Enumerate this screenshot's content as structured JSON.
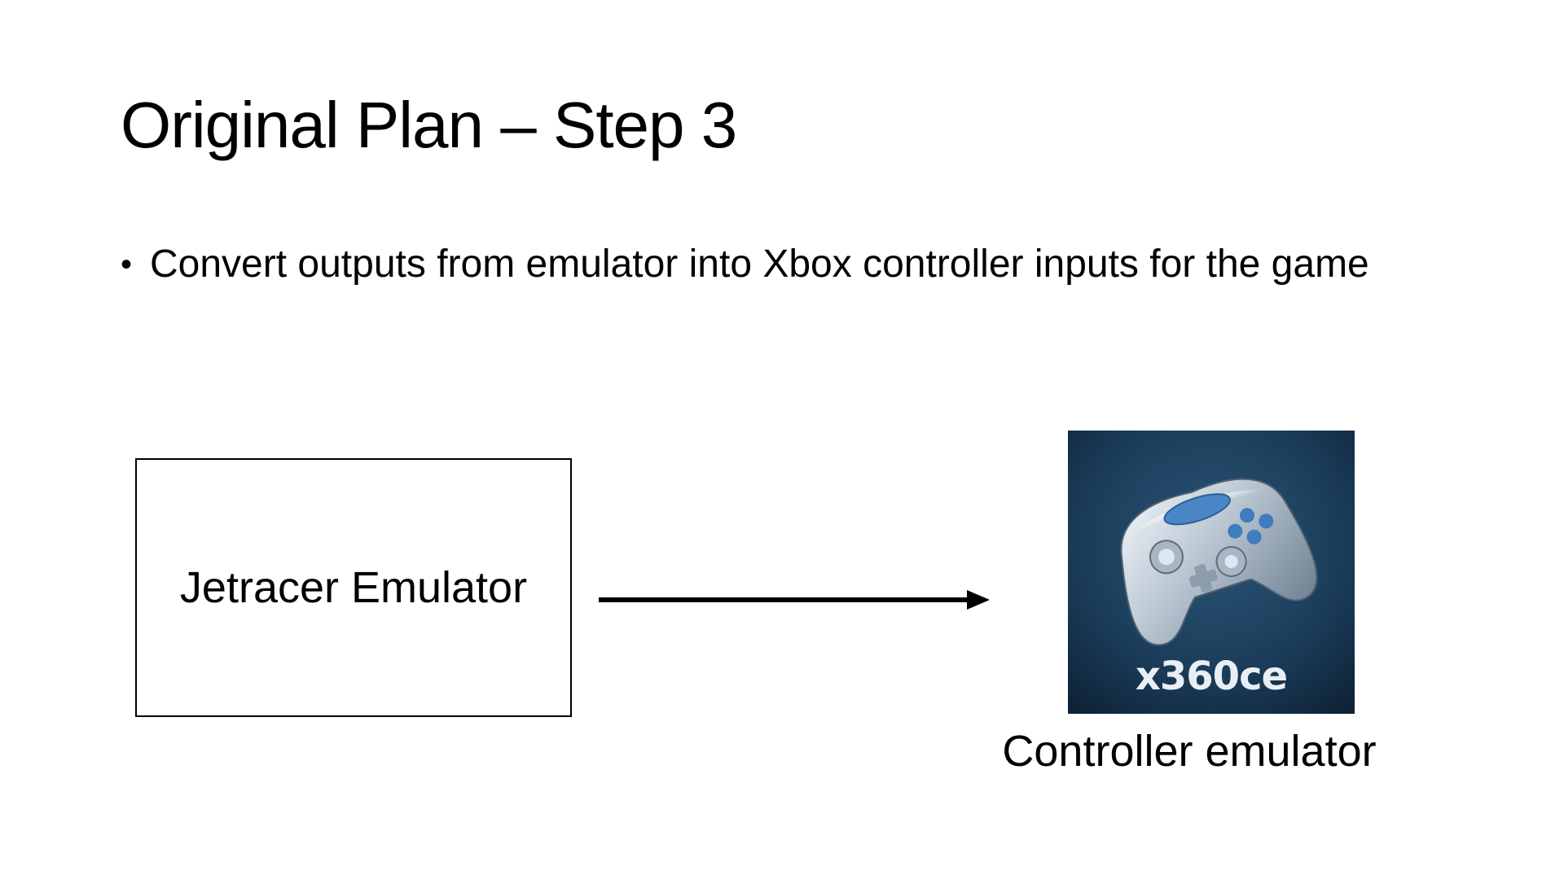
{
  "slide": {
    "title": "Original Plan – Step 3",
    "bullets": [
      {
        "text": "Convert outputs from emulator into Xbox controller inputs for the game"
      }
    ],
    "bullet_symbol": "•"
  },
  "diagram": {
    "source_box": {
      "label": "Jetracer Emulator"
    },
    "arrow": {
      "direction": "right",
      "color": "#000000"
    },
    "target": {
      "icon_name": "gamepad-icon",
      "icon_caption": "x360ce",
      "caption": "Controller emulator",
      "tile_color": "#17354f"
    }
  }
}
